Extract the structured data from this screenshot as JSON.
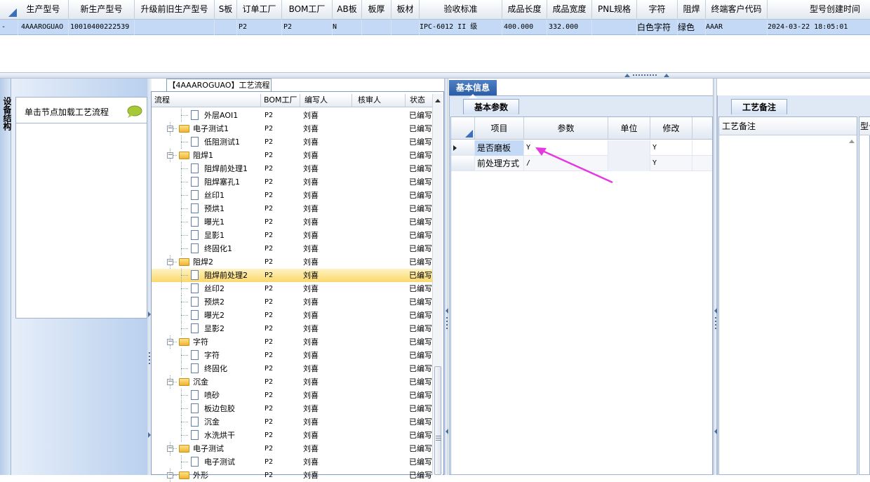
{
  "top_grid": {
    "columns": [
      "生产型号",
      "新生产型号",
      "升级前旧生产型号",
      "S板",
      "订单工厂",
      "BOM工厂",
      "AB板",
      "板厚",
      "板材",
      "验收标准",
      "成品长度",
      "成品宽度",
      "PNL规格",
      "字符",
      "阻焊",
      "终端客户代码",
      "型号创建时间"
    ],
    "row": {
      "marker": "-",
      "values": [
        "4AAAROGUAO",
        "10010400222539",
        "",
        "",
        "P2",
        "P2",
        "N",
        "",
        "",
        "IPC-6012 II 级",
        "400.000",
        "332.000",
        "",
        "白色字符",
        "绿色",
        "AAAR",
        "2024-03-22 18:05:01"
      ]
    }
  },
  "left_panel": {
    "vertical_tab": "设备结构",
    "hint": "单击节点加载工艺流程"
  },
  "tree": {
    "title": "【4AAAROGUAO】工艺流程",
    "headers": [
      "流程",
      "BOM工厂",
      "编写人",
      "核审人",
      "状态"
    ],
    "rows": [
      {
        "name": "外层AOI1",
        "type": "leaf",
        "bom": "P2",
        "writer": "刘喜",
        "status": "已编写"
      },
      {
        "name": "电子测试1",
        "type": "folder",
        "bom": "P2",
        "writer": "刘喜",
        "status": "已编写"
      },
      {
        "name": "低阻测试1",
        "type": "leaf",
        "bom": "P2",
        "writer": "刘喜",
        "status": "已编写"
      },
      {
        "name": "阻焊1",
        "type": "folder",
        "bom": "P2",
        "writer": "刘喜",
        "status": "已编写"
      },
      {
        "name": "阻焊前处理1",
        "type": "leaf",
        "bom": "P2",
        "writer": "刘喜",
        "status": "已编写"
      },
      {
        "name": "阻焊塞孔1",
        "type": "leaf",
        "bom": "P2",
        "writer": "刘喜",
        "status": "已编写"
      },
      {
        "name": "丝印1",
        "type": "leaf",
        "bom": "P2",
        "writer": "刘喜",
        "status": "已编写"
      },
      {
        "name": "预烘1",
        "type": "leaf",
        "bom": "P2",
        "writer": "刘喜",
        "status": "已编写"
      },
      {
        "name": "曝光1",
        "type": "leaf",
        "bom": "P2",
        "writer": "刘喜",
        "status": "已编写"
      },
      {
        "name": "显影1",
        "type": "leaf",
        "bom": "P2",
        "writer": "刘喜",
        "status": "已编写"
      },
      {
        "name": "终固化1",
        "type": "leaf",
        "bom": "P2",
        "writer": "刘喜",
        "status": "已编写"
      },
      {
        "name": "阻焊2",
        "type": "folder",
        "bom": "P2",
        "writer": "刘喜",
        "status": "已编写"
      },
      {
        "name": "阻焊前处理2",
        "type": "leaf",
        "bom": "P2",
        "writer": "刘喜",
        "status": "已编写",
        "selected": true
      },
      {
        "name": "丝印2",
        "type": "leaf",
        "bom": "P2",
        "writer": "刘喜",
        "status": "已编写"
      },
      {
        "name": "预烘2",
        "type": "leaf",
        "bom": "P2",
        "writer": "刘喜",
        "status": "已编写"
      },
      {
        "name": "曝光2",
        "type": "leaf",
        "bom": "P2",
        "writer": "刘喜",
        "status": "已编写"
      },
      {
        "name": "显影2",
        "type": "leaf",
        "bom": "P2",
        "writer": "刘喜",
        "status": "已编写"
      },
      {
        "name": "字符",
        "type": "folder",
        "bom": "P2",
        "writer": "刘喜",
        "status": "已编写"
      },
      {
        "name": "字符",
        "type": "leaf",
        "bom": "P2",
        "writer": "刘喜",
        "status": "已编写"
      },
      {
        "name": "终固化",
        "type": "leaf",
        "bom": "P2",
        "writer": "刘喜",
        "status": "已编写"
      },
      {
        "name": "沉金",
        "type": "folder",
        "bom": "P2",
        "writer": "刘喜",
        "status": "已编写"
      },
      {
        "name": "喷砂",
        "type": "leaf",
        "bom": "P2",
        "writer": "刘喜",
        "status": "已编写"
      },
      {
        "name": "板边包胶",
        "type": "leaf",
        "bom": "P2",
        "writer": "刘喜",
        "status": "已编写"
      },
      {
        "name": "沉金",
        "type": "leaf",
        "bom": "P2",
        "writer": "刘喜",
        "status": "已编写"
      },
      {
        "name": "水洗烘干",
        "type": "leaf",
        "bom": "P2",
        "writer": "刘喜",
        "status": "已编写"
      },
      {
        "name": "电子测试",
        "type": "folder",
        "bom": "P2",
        "writer": "刘喜",
        "status": "已编写"
      },
      {
        "name": "电子测试",
        "type": "leaf",
        "bom": "P2",
        "writer": "刘喜",
        "status": "已编写"
      },
      {
        "name": "外形",
        "type": "folder",
        "bom": "P2",
        "writer": "刘喜",
        "status": "已编写"
      }
    ]
  },
  "basic_info": {
    "tab": "基本信息",
    "subtab": "基本参数",
    "headers": [
      "项目",
      "参数",
      "单位",
      "修改"
    ],
    "rows": [
      {
        "item": "是否磨板",
        "param": "Y",
        "unit": "",
        "modify": "Y"
      },
      {
        "item": "前处理方式",
        "param": "/",
        "unit": "",
        "modify": "Y"
      }
    ]
  },
  "notes": {
    "tab": "工艺备注",
    "header": "工艺备注",
    "header2": "型号"
  },
  "colors": {
    "accent": "#2c5ea5",
    "selection": "#fbd86a",
    "arrow": "#e838e0"
  }
}
